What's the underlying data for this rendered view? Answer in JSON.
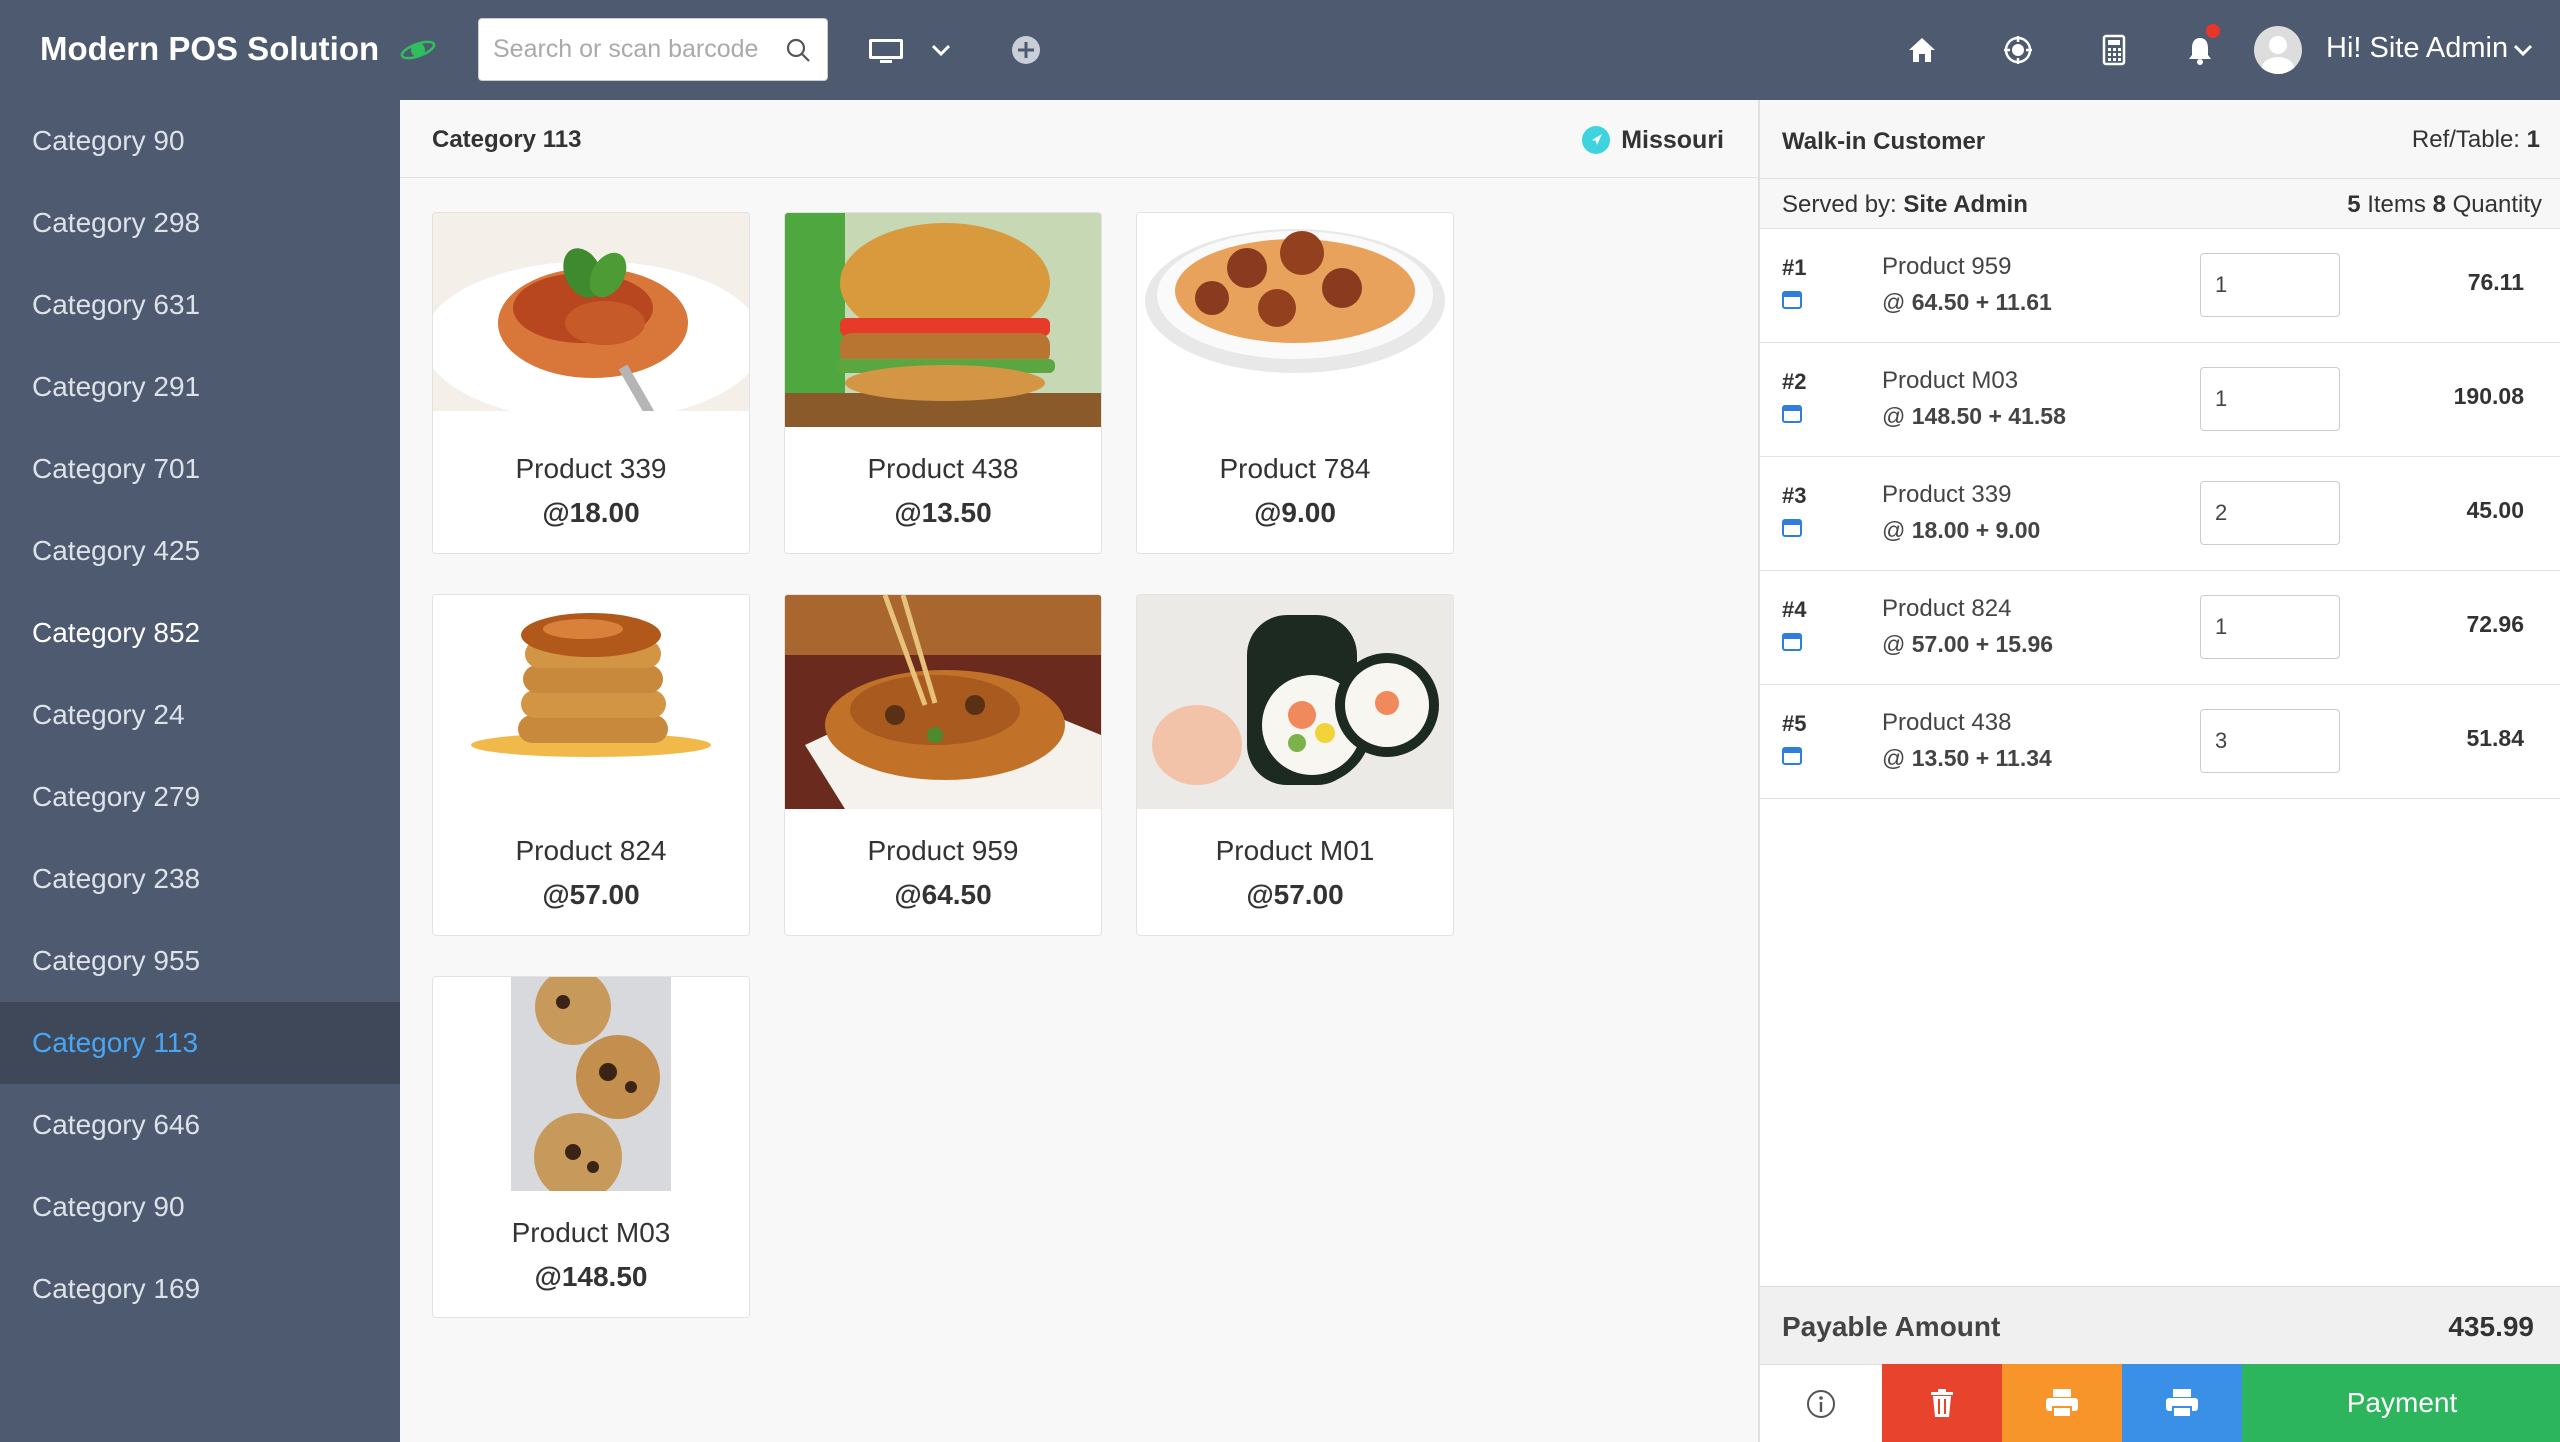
{
  "app": {
    "brand": "Modern POS Solution",
    "search_placeholder": "Search or scan barcode",
    "greeting": "Hi! Site Admin"
  },
  "sidebar": {
    "items": [
      {
        "label": "Category 90"
      },
      {
        "label": "Category 298"
      },
      {
        "label": "Category 631"
      },
      {
        "label": "Category 291"
      },
      {
        "label": "Category 701"
      },
      {
        "label": "Category 425"
      },
      {
        "label": "Category 852"
      },
      {
        "label": "Category 24"
      },
      {
        "label": "Category 279"
      },
      {
        "label": "Category 238"
      },
      {
        "label": "Category 955"
      },
      {
        "label": "Category 113"
      },
      {
        "label": "Category 646"
      },
      {
        "label": "Category 90"
      },
      {
        "label": "Category 169"
      }
    ],
    "active": "Category 113"
  },
  "main": {
    "category_title": "Category 113",
    "location": "Missouri",
    "products": [
      {
        "name": "Product 339",
        "price": "@18.00",
        "image": "spaghetti-bolognese"
      },
      {
        "name": "Product 438",
        "price": "@13.50",
        "image": "burger"
      },
      {
        "name": "Product 784",
        "price": "@9.00",
        "image": "spaghetti-meatballs"
      },
      {
        "name": "Product 824",
        "price": "@57.00",
        "image": "pancakes"
      },
      {
        "name": "Product 959",
        "price": "@64.50",
        "image": "noodles"
      },
      {
        "name": "Product M01",
        "price": "@57.00",
        "image": "sushi"
      },
      {
        "name": "Product M03",
        "price": "@148.50",
        "image": "cookies"
      }
    ]
  },
  "cart": {
    "customer": "Walk-in Customer",
    "ref_label": "Ref/Table:",
    "ref_value": "1",
    "served_label": "Served by:",
    "served_by": "Site Admin",
    "items_count": "5",
    "items_label": "Items",
    "quantity_count": "8",
    "quantity_label": "Quantity",
    "lines": [
      {
        "num": "#1",
        "name": "Product 959",
        "at": "@",
        "price": "64.50 + 11.61",
        "qty": "1",
        "total": "76.11"
      },
      {
        "num": "#2",
        "name": "Product M03",
        "at": "@",
        "price": "148.50 + 41.58",
        "qty": "1",
        "total": "190.08"
      },
      {
        "num": "#3",
        "name": "Product 339",
        "at": "@",
        "price": "18.00 + 9.00",
        "qty": "2",
        "total": "45.00"
      },
      {
        "num": "#4",
        "name": "Product 824",
        "at": "@",
        "price": "57.00 + 15.96",
        "qty": "1",
        "total": "72.96"
      },
      {
        "num": "#5",
        "name": "Product 438",
        "at": "@",
        "price": "13.50 + 11.34",
        "qty": "3",
        "total": "51.84"
      }
    ],
    "payable_label": "Payable Amount",
    "payable_amount": "435.99",
    "payment_label": "Payment"
  },
  "colors": {
    "topbar": "#4e5a70",
    "sidebar_active_bg": "#3e4859",
    "sidebar_active_text": "#4aa6f5",
    "delete": "#e8432c",
    "print_orange": "#f7952a",
    "print_blue": "#3a8fe6",
    "payment": "#2db55d"
  }
}
